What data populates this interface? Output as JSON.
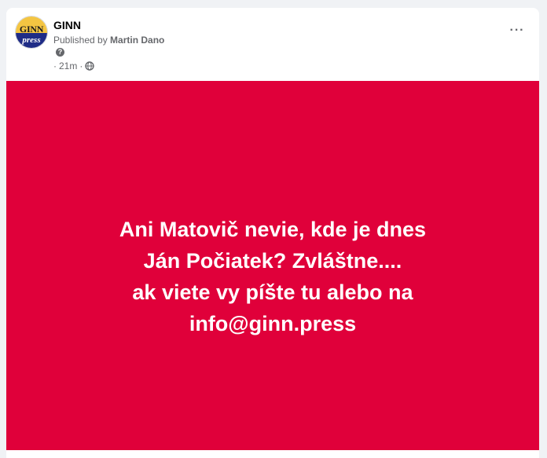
{
  "post": {
    "page_name": "GINN",
    "published_prefix": "Published by ",
    "author": "Martin Dano",
    "help_glyph": "?",
    "meta_prefix": "· ",
    "time": "21m",
    "meta_sep": " ·",
    "more_label": "···",
    "avatar": {
      "top_text": "GINN",
      "bottom_text": "press"
    }
  },
  "banner": {
    "lines": [
      "Ani Matovič nevie, kde je dnes",
      "Ján Počiatek? Zvláštne....",
      "ak viete vy píšte tu alebo na",
      "info@ginn.press"
    ],
    "bg_color": "#e0003a"
  },
  "icons": {
    "globe": "globe-icon",
    "help": "help-icon",
    "more": "more-icon"
  }
}
